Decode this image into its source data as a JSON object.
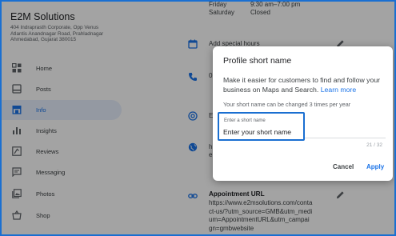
{
  "sidebar": {
    "business_name": "E2M Solutions",
    "business_address": "404 Indraprasth Corporate, Opp Venus Atlantis Anandnagar Road, Prahladnagar Ahmedabad, Gujarat 380015",
    "items": [
      {
        "label": "Home",
        "icon": "home-icon"
      },
      {
        "label": "Posts",
        "icon": "posts-icon"
      },
      {
        "label": "Info",
        "icon": "info-icon",
        "active": true
      },
      {
        "label": "Insights",
        "icon": "insights-icon"
      },
      {
        "label": "Reviews",
        "icon": "reviews-icon"
      },
      {
        "label": "Messaging",
        "icon": "messaging-icon"
      },
      {
        "label": "Photos",
        "icon": "photos-icon"
      },
      {
        "label": "Shop",
        "icon": "shop-icon"
      }
    ]
  },
  "main": {
    "hours": [
      {
        "day": "Friday",
        "time": "9:30 am–7:00 pm"
      },
      {
        "day": "Saturday",
        "time": "Closed"
      }
    ],
    "add_special_hours": "Add special hours",
    "phone_fragment": "0",
    "email_fragment": "E",
    "website_fragment": "h e",
    "appointment": {
      "title": "Appointment URL",
      "url": "https://www.e2msolutions.com/contact-us/?utm_source=GMB&utm_medium=AppointmentURL&utm_campaign=gmbwebsite"
    }
  },
  "dialog": {
    "title": "Profile short name",
    "description": "Make it easier for customers to find and follow your business on Maps and Search.",
    "learn_more": "Learn more",
    "note": "Your short name can be changed 3 times per year",
    "field_label": "Enter a short name",
    "field_placeholder": "Enter your short name",
    "counter": "21 / 32",
    "cancel_label": "Cancel",
    "apply_label": "Apply"
  },
  "colors": {
    "accent": "#1a73e8",
    "highlight_border": "#1a6fd1",
    "scrim": "rgba(0,0,0,0.36)"
  }
}
